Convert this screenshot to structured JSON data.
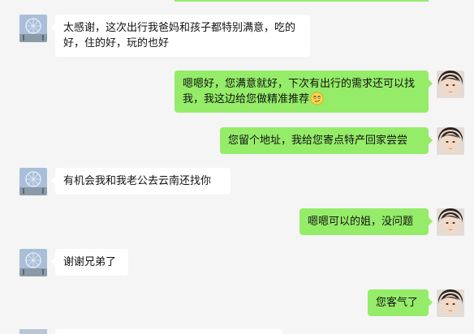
{
  "colors": {
    "background": "#f5f5f5",
    "incoming_bubble": "#ffffff",
    "outgoing_bubble": "#95ec69",
    "text": "#111111"
  },
  "messages": [
    {
      "side": "incoming",
      "text": "太感谢，这次出行我爸妈和孩子都特别满意，吃的好，住的好，玩的也好"
    },
    {
      "side": "outgoing",
      "text": "嗯嗯好，您满意就好，下次有出行的需求还可以找我，我这边给您做精准推荐",
      "emoji": "smirk-emoji"
    },
    {
      "side": "outgoing",
      "text": "您留个地址，我给您寄点特产回家尝尝"
    },
    {
      "side": "incoming",
      "text": "有机会我和我老公去云南还找你"
    },
    {
      "side": "outgoing",
      "text": "嗯嗯可以的姐，没问题"
    },
    {
      "side": "incoming",
      "text": "谢谢兄弟了"
    },
    {
      "side": "outgoing",
      "text": "您客气了"
    }
  ],
  "avatars": {
    "incoming": "ferris-wheel-avatar",
    "outgoing": "portrait-avatar"
  }
}
